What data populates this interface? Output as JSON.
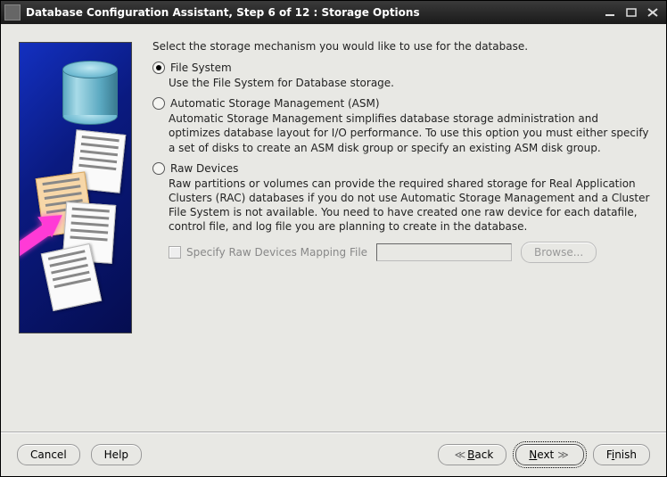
{
  "window": {
    "title": "Database Configuration Assistant, Step 6 of 12 : Storage Options"
  },
  "intro": "Select the storage mechanism you would like to use for the database.",
  "options": {
    "filesystem": {
      "title": "File System",
      "desc": "Use the File System for Database storage.",
      "selected": true
    },
    "asm": {
      "title": "Automatic Storage Management (ASM)",
      "desc": "Automatic Storage Management simplifies database storage administration and optimizes database layout for I/O performance. To use this option you must either specify a set of disks to create an ASM disk group or specify an existing ASM disk group.",
      "selected": false
    },
    "raw": {
      "title": "Raw Devices",
      "desc": "Raw partitions or volumes can provide the required shared storage for Real Application Clusters (RAC) databases if you do not use Automatic Storage Management and a Cluster File System is not available.  You need to have created one raw device for each datafile, control file, and log file you are planning to create in the database.",
      "selected": false,
      "mapping_label": "Specify Raw Devices Mapping File",
      "mapping_value": "",
      "browse_label": "Browse..."
    }
  },
  "footer": {
    "cancel": "Cancel",
    "help": "Help",
    "back": "Back",
    "next": "Next",
    "finish": "Finish"
  }
}
